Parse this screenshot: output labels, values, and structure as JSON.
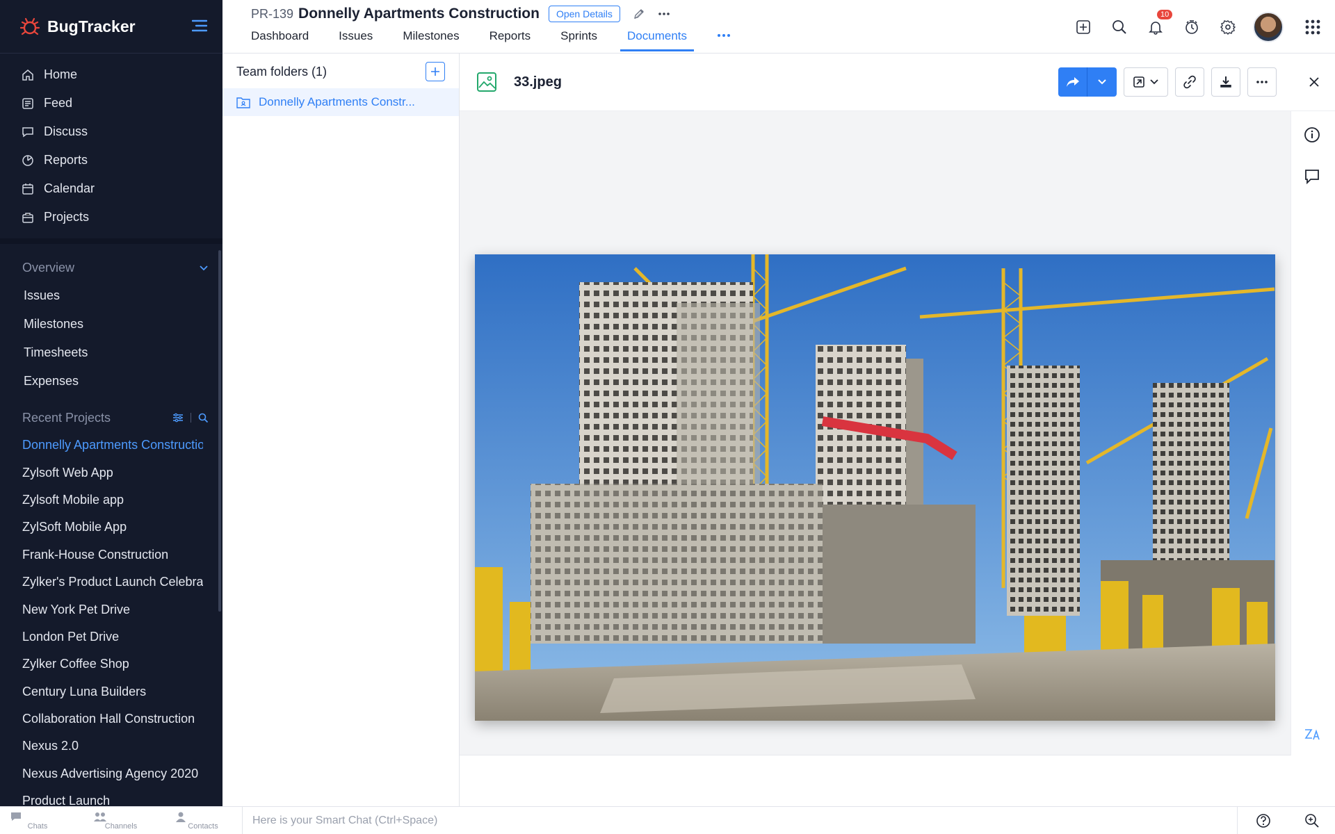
{
  "app": {
    "name": "BugTracker",
    "accent": "#2f7ff5",
    "sidebar_bg": "#141a2b"
  },
  "sidebar": {
    "main_nav": [
      {
        "label": "Home",
        "icon": "home-icon"
      },
      {
        "label": "Feed",
        "icon": "feed-icon"
      },
      {
        "label": "Discuss",
        "icon": "discuss-icon"
      },
      {
        "label": "Reports",
        "icon": "reports-icon"
      },
      {
        "label": "Calendar",
        "icon": "calendar-icon"
      },
      {
        "label": "Projects",
        "icon": "projects-icon"
      }
    ],
    "overview": {
      "title": "Overview",
      "items": [
        "Issues",
        "Milestones",
        "Timesheets",
        "Expenses"
      ]
    },
    "recent": {
      "title": "Recent Projects",
      "items": [
        "Donnelly Apartments Construction",
        "Zylsoft Web App",
        "Zylsoft Mobile app",
        "ZylSoft Mobile App",
        "Frank-House Construction",
        "Zylker's Product Launch Celebration",
        "New York Pet Drive",
        "London Pet Drive",
        "Zylker Coffee Shop",
        "Century Luna Builders",
        "Collaboration Hall Construction",
        "Nexus 2.0",
        "Nexus Advertising Agency 2020",
        "Product Launch"
      ]
    }
  },
  "header": {
    "project_id": "PR-139",
    "project_title": "Donnelly Apartments Construction",
    "open_details": "Open Details",
    "tabs": [
      "Dashboard",
      "Issues",
      "Milestones",
      "Reports",
      "Sprints",
      "Documents"
    ],
    "active_tab": "Documents",
    "notification_count": "10"
  },
  "folders": {
    "title": "Team folders (1)",
    "items": [
      "Donnelly Apartments Constr..."
    ]
  },
  "viewer": {
    "file_name": "33.jpeg"
  },
  "bottom_bar": {
    "tabs": [
      "Chats",
      "Channels",
      "Contacts"
    ],
    "smart_chat_placeholder": "Here is your Smart Chat (Ctrl+Space)"
  }
}
